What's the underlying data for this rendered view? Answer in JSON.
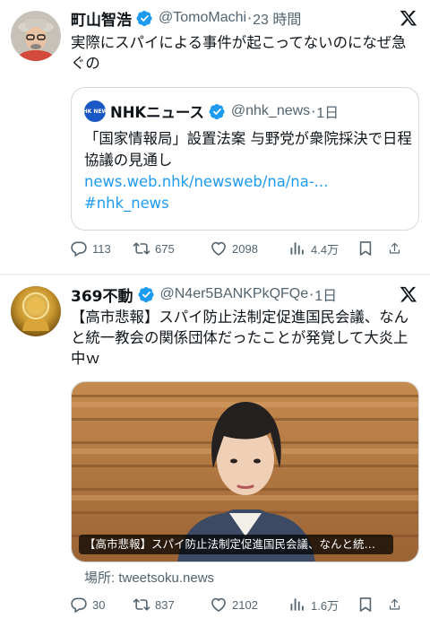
{
  "tweets": [
    {
      "name": "町山智浩",
      "handle": "@TomoMachi",
      "time": "23 時間",
      "text": "実際にスパイによる事件が起こってないのになぜ急ぐの",
      "quote": {
        "avatar_text": "NHK NEWS",
        "name": "NHKニュース",
        "handle": "@nhk_news",
        "time": "1日",
        "text": "「国家情報局」設置法案 与野党が衆院採決で日程協議の見通し",
        "link": "news.web.nhk/newsweb/na/na-...",
        "hashtag": "#nhk_news"
      },
      "stats": {
        "replies": "113",
        "retweets": "675",
        "likes": "2098",
        "views": "4.4万"
      }
    },
    {
      "name": "369不動",
      "handle": "@N4er5BANKPkQFQe",
      "time": "1日",
      "text": "【高市悲報】スパイ防止法制定促進国民会議、なんと統一教会の関係団体だったことが発覚して大炎上中ｗ",
      "card": {
        "title": "【高市悲報】スパイ防止法制定促進国民会議、なんと統…",
        "source": "場所: tweetsoku.news"
      },
      "stats": {
        "replies": "30",
        "retweets": "837",
        "likes": "2102",
        "views": "1.6万"
      }
    }
  ],
  "colors": {
    "accent": "#1d9bf0",
    "secondary_text": "#536471",
    "verified": "#1d9bf0",
    "border": "#cfd9de"
  },
  "icons": [
    "verified-badge-icon",
    "x-logo-icon",
    "reply-icon",
    "retweet-icon",
    "like-icon",
    "views-icon",
    "bookmark-icon",
    "share-icon"
  ]
}
